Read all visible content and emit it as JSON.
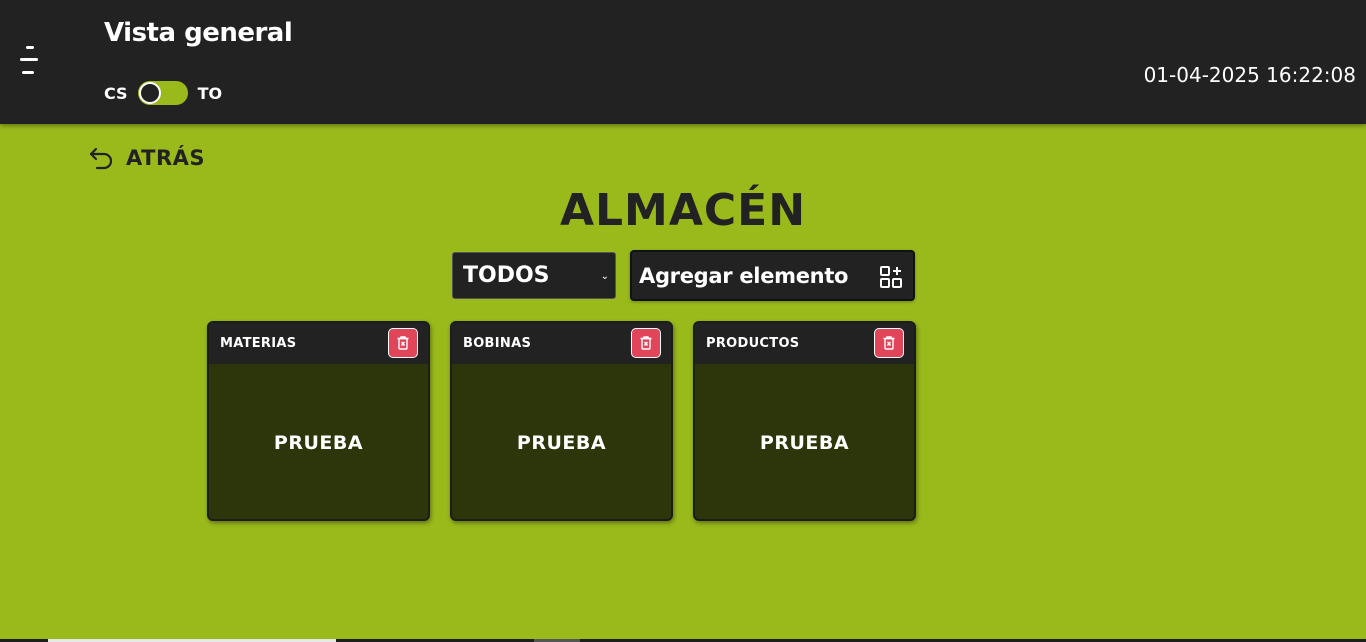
{
  "header": {
    "title": "Vista general",
    "toggle": {
      "left_label": "CS",
      "right_label": "TO",
      "accent": "#9aba1c"
    },
    "datetime": "01-04-2025 16:22:08",
    "menu_icon": "menu-icon"
  },
  "nav": {
    "back_label": "ATRÁS",
    "back_icon": "undo-arrow-icon"
  },
  "main": {
    "title": "ALMACÉN",
    "filter": {
      "selected": "TODOS"
    },
    "add_button": {
      "label": "Agregar elemento",
      "icon": "add-grid-icon"
    },
    "cards": [
      {
        "title": "MATERIAS",
        "content": "PRUEBA"
      },
      {
        "title": "BOBINAS",
        "content": "PRUEBA"
      },
      {
        "title": "PRODUCTOS",
        "content": "PRUEBA"
      }
    ]
  },
  "colors": {
    "background": "#9aba1c",
    "header": "#222222",
    "card_body": "#2d360a",
    "delete": "#e0455a"
  }
}
